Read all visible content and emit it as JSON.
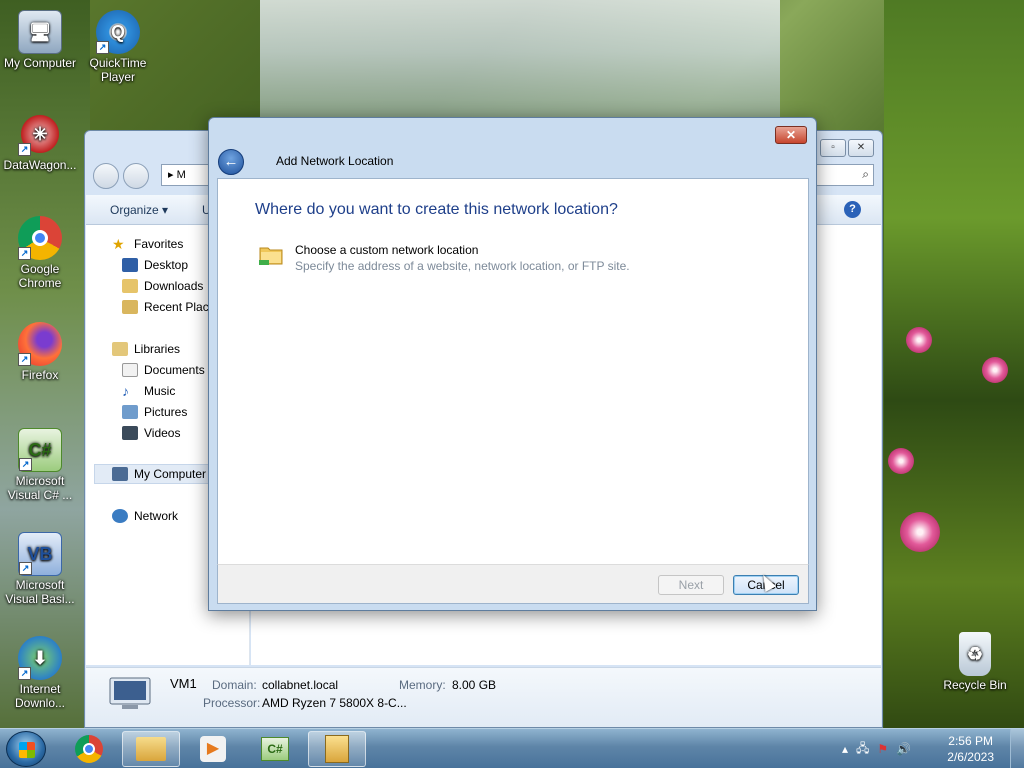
{
  "desktop": {
    "icons": [
      {
        "label": "My Computer"
      },
      {
        "label": "QuickTime Player"
      },
      {
        "label": "DataWagon..."
      },
      {
        "label": "Google Chrome"
      },
      {
        "label": "Firefox"
      },
      {
        "label": "Microsoft Visual C# ..."
      },
      {
        "label": "Microsoft Visual Basi..."
      },
      {
        "label": "Internet Downlo..."
      },
      {
        "label": "Recycle Bin"
      }
    ]
  },
  "explorer": {
    "address_text": "M",
    "organize_label": "Organize ▾",
    "cmd_partial": "U",
    "nav": {
      "favorites": "Favorites",
      "desktop": "Desktop",
      "downloads": "Downloads",
      "recent": "Recent Places",
      "libraries": "Libraries",
      "documents": "Documents",
      "music": "Music",
      "pictures": "Pictures",
      "videos": "Videos",
      "my_computer": "My Computer",
      "network": "Network"
    },
    "details": {
      "name": "VM1",
      "domain_label": "Domain:",
      "domain_value": "collabnet.local",
      "memory_label": "Memory:",
      "memory_value": "8.00 GB",
      "processor_label": "Processor:",
      "processor_value": "AMD Ryzen 7 5800X 8-C..."
    }
  },
  "dialog": {
    "title": "Add Network Location",
    "heading": "Where do you want to create this network location?",
    "option_title": "Choose a custom network location",
    "option_desc": "Specify the address of a website, network location, or FTP site.",
    "next_label": "Next",
    "cancel_label": "Cancel",
    "close_glyph": "✕",
    "back_glyph": "←"
  },
  "taskbar": {
    "time": "2:56 PM",
    "date": "2/6/2023"
  },
  "colors": {
    "heading_blue": "#1e3f8a",
    "taskbar": "#5e85a8"
  }
}
